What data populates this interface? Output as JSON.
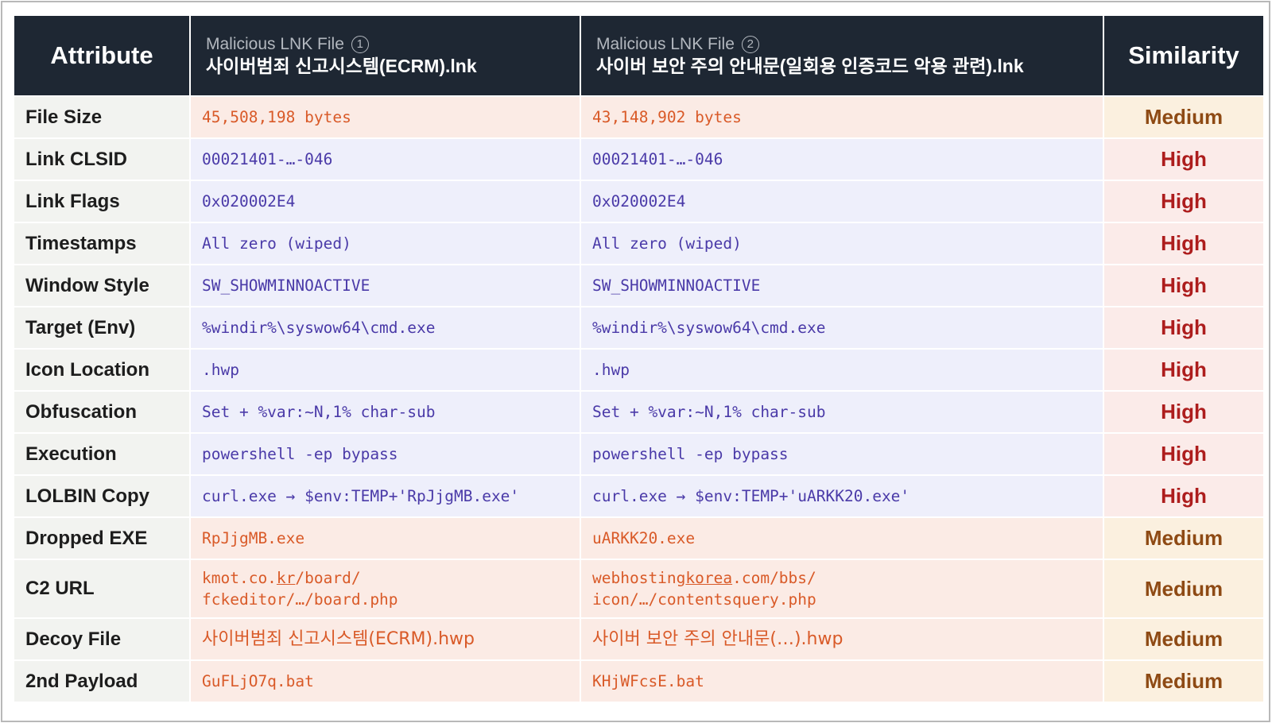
{
  "header": {
    "attribute": "Attribute",
    "file1_label": "Malicious LNK File",
    "file1_num": "1",
    "file1_name": "사이버범죄 신고시스템(ECRM).lnk",
    "file2_label": "Malicious LNK File",
    "file2_num": "2",
    "file2_name": "사이버 보안 주의 안내문(일회용 인증코드 악용 관련).lnk",
    "similarity": "Similarity"
  },
  "rows": [
    {
      "attr": "File Size",
      "v1": "45,508,198 bytes",
      "v2": "43,148,902 bytes",
      "sim": "Medium"
    },
    {
      "attr": "Link CLSID",
      "v1": "00021401-…-046",
      "v2": "00021401-…-046",
      "sim": "High"
    },
    {
      "attr": "Link Flags",
      "v1": "0x020002E4",
      "v2": "0x020002E4",
      "sim": "High"
    },
    {
      "attr": "Timestamps",
      "v1": "All zero (wiped)",
      "v2": "All zero (wiped)",
      "sim": "High"
    },
    {
      "attr": "Window Style",
      "v1": "SW_SHOWMINNOACTIVE",
      "v2": "SW_SHOWMINNOACTIVE",
      "sim": "High"
    },
    {
      "attr": "Target (Env)",
      "v1": "%windir%\\syswow64\\cmd.exe",
      "v2": "%windir%\\syswow64\\cmd.exe",
      "sim": "High"
    },
    {
      "attr": "Icon Location",
      "v1": ".hwp",
      "v2": ".hwp",
      "sim": "High"
    },
    {
      "attr": "Obfuscation",
      "v1": "Set + %var:~N,1% char-sub",
      "v2": "Set + %var:~N,1% char-sub",
      "sim": "High"
    },
    {
      "attr": "Execution",
      "v1": "powershell -ep bypass",
      "v2": "powershell -ep bypass",
      "sim": "High"
    },
    {
      "attr": "LOLBIN Copy",
      "v1": "curl.exe → $env:TEMP+'RpJjgMB.exe'",
      "v2": "curl.exe → $env:TEMP+'uARKK20.exe'",
      "sim": "High"
    },
    {
      "attr": "Dropped EXE",
      "v1": "RpJjgMB.exe",
      "v2": "uARKK20.exe",
      "sim": "Medium"
    },
    {
      "attr": "C2 URL",
      "v1_a": "kmot.co.",
      "v1_b": "kr",
      "v1_c": "/board/",
      "v1_line2": "fckeditor/…/board.php",
      "v2_a": "webhosting",
      "v2_b": "korea",
      "v2_c": ".com/bbs/",
      "v2_line2": "icon/…/contentsquery.php",
      "sim": "Medium"
    },
    {
      "attr": "Decoy File",
      "v1": "사이버범죄 신고시스템(ECRM).hwp",
      "v2": "사이버 보안 주의 안내문(…).hwp",
      "sim": "Medium"
    },
    {
      "attr": "2nd Payload",
      "v1": "GuFLjO7q.bat",
      "v2": "KHjWFcsE.bat",
      "sim": "Medium"
    }
  ],
  "colors": {
    "header_bg": "#1e2733",
    "high_value": "#4a3aa8",
    "medium_value": "#d95a28",
    "high_label": "#ad1d1d",
    "medium_label": "#8e4a14"
  }
}
